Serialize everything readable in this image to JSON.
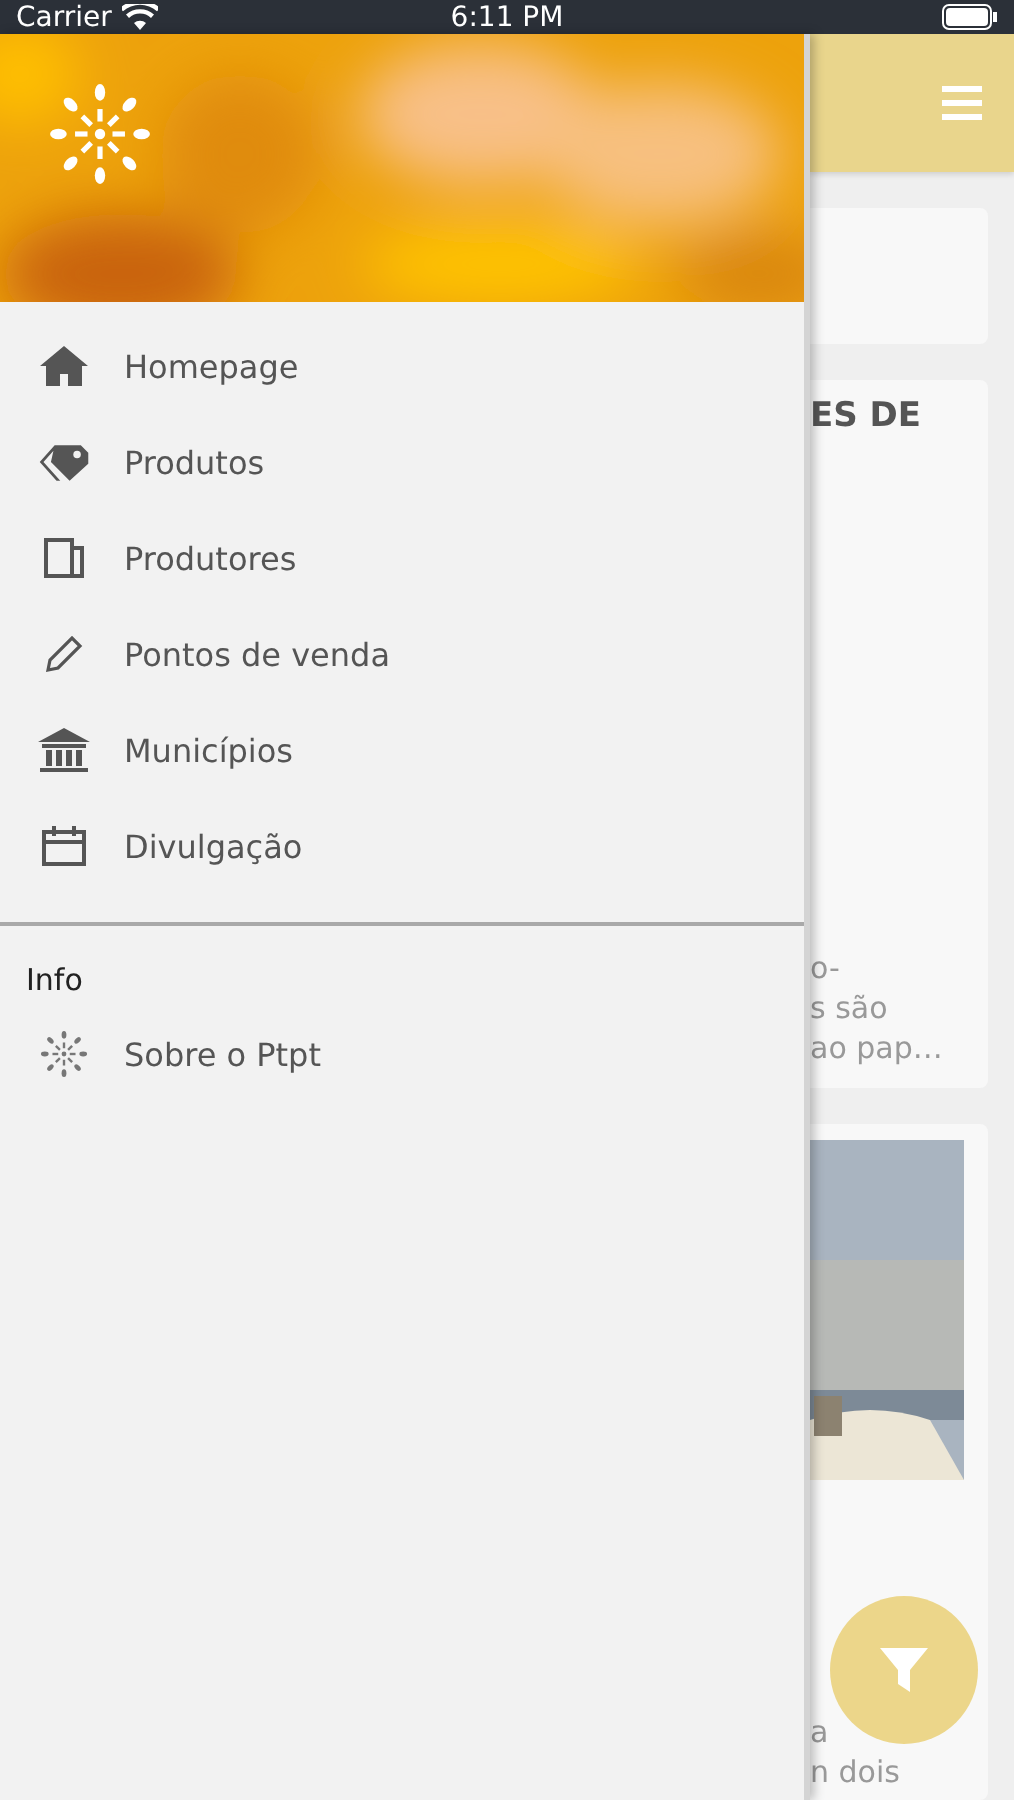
{
  "status_bar": {
    "carrier": "Carrier",
    "time": "6:11 PM"
  },
  "drawer": {
    "header": {
      "kind": "picture"
    },
    "menu": [
      {
        "label": "Homepage"
      },
      {
        "label": "Produtos"
      },
      {
        "label": "Produtores"
      },
      {
        "label": "Pontos de venda"
      },
      {
        "label": "Municípios"
      },
      {
        "label": "Divulgação"
      }
    ],
    "section_title": "Info",
    "info_items": [
      {
        "label": "Sobre o Ptpt"
      }
    ]
  },
  "background": {
    "cards": [
      {
        "kind": "blank"
      },
      {
        "kind": "text",
        "title": "ES DE",
        "lines": [
          "o-",
          "s são",
          "ao pap…"
        ]
      },
      {
        "image": {
          "kind": "picture"
        },
        "lines": [
          "a",
          "n dois"
        ]
      }
    ]
  }
}
